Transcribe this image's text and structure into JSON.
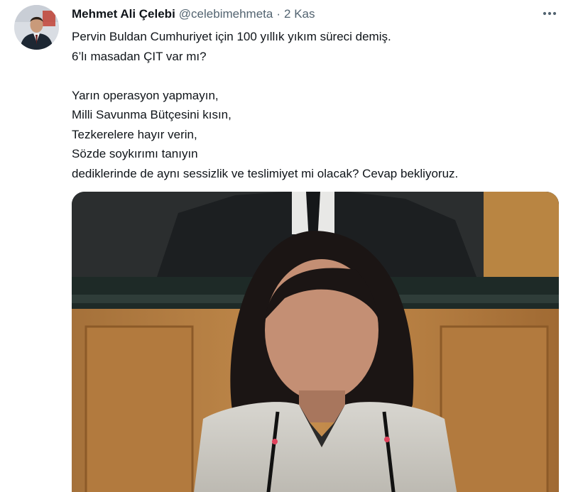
{
  "tweet": {
    "author": {
      "display_name": "Mehmet Ali Çelebi",
      "handle": "@celebimehmeta",
      "avatar_icon": "profile-photo"
    },
    "separator": "·",
    "time": "2 Kas",
    "more_icon": "more-horizontal-icon",
    "lines": [
      "Pervin Buldan Cumhuriyet için 100 yıllık yıkım süreci demiş.",
      "6’lı masadan ÇIT var mı?",
      "",
      "Yarın operasyon yapmayın,",
      "Milli Savunma Bütçesini kısın,",
      "Tezkerelere hayır verin,",
      "Sözde soykırımı tanıyın",
      "dediklerinde de aynı sessizlik ve teslimiyet mi olacak? Cevap bekliyoruz."
    ],
    "media": {
      "type": "video-thumbnail"
    }
  },
  "colors": {
    "text_primary": "#0f1419",
    "text_secondary": "#536471",
    "background": "#ffffff"
  }
}
